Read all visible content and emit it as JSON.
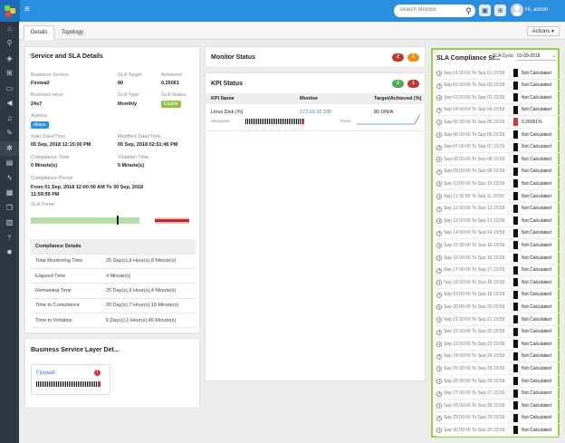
{
  "header": {
    "search_placeholder": "Search Monitor",
    "user_greeting": "Hi, admin"
  },
  "tabs": [
    {
      "label": "Details"
    },
    {
      "label": "Topology"
    }
  ],
  "actions_label": "Actions",
  "service": {
    "title": "Service and SLA Details",
    "fields": {
      "business_service_label": "Business Service",
      "business_service": "Firewall",
      "sla_target_label": "SLA Target",
      "sla_target": "80",
      "achieved_label": "Achieved",
      "achieved": "0.25061",
      "business_hour_label": "Business Hour",
      "business_hour": "24x7",
      "sla_type_label": "SLA Type",
      "sla_type": "Monthly",
      "sla_status_label": "SLA Status",
      "sla_status": "Enable",
      "actions_label": "Actions",
      "actions_badge": "dbase",
      "start_label": "Start Date/Time",
      "start": "05 Sep, 2018 12:15:00 PM",
      "modified_label": "Modified Date/Time",
      "modified": "05 Sep, 2018 02:51:46 PM",
      "compliance_time_label": "Compliance Time",
      "compliance_time": "0 Minute(s)",
      "violation_time_label": "Violation Time",
      "violation_time": "5 Minute(s)",
      "compliance_period_label": "Compliance Period",
      "compliance_period": "From 01 Sep, 2018 12:00:00 AM To 30 Sep, 2018 11:59:59 PM",
      "sla_trend_label": "SLA Trend"
    },
    "compliance_details": {
      "header": "Compliance Details",
      "rows": [
        {
          "label": "Total Monitoring Time",
          "value": "25 Day(s),9 Hour(s),8 Minute(s)"
        },
        {
          "label": "Elapsed Time",
          "value": "4 Minute(s)"
        },
        {
          "label": "Remaining Time",
          "value": "25 Day(s),9 Hour(s),4 Minute(s)"
        },
        {
          "label": "Time to Compliance",
          "value": "20 Day(s),7 Hour(s),18 Minute(s)"
        },
        {
          "label": "Time to Violation",
          "value": "5 Day(s),1 Hour(s),45 Minute(s)"
        }
      ]
    }
  },
  "layer": {
    "title": "Business Service Layer Det...",
    "card_name": "Firewall"
  },
  "monitor_status": {
    "title": "Monitor Status",
    "count_red": "2",
    "count_orange": "1"
  },
  "kpi_status": {
    "title": "KPI Status",
    "count_green": "2",
    "count_red": "1",
    "headers": [
      "KPI Name",
      "Monitor",
      "Target/Achieved (%)"
    ],
    "row": {
      "name": "Linux Disk (%)",
      "monitor": "172.16.10.230",
      "target_achieved": "80.0/N/A",
      "histogram_label": "Histogram",
      "trend_label": "Trend"
    }
  },
  "sla_compliance": {
    "title": "SLA Compliance St...",
    "cycle_label": "SLA Cycle",
    "cycle_value": "01-09-2018",
    "rows": [
      {
        "period": "Sep 01 00:00 To Sep 01 23:59",
        "status": "Not Calculated",
        "color": "#111111"
      },
      {
        "period": "Sep 02 00:00 To Sep 02 23:59",
        "status": "Not Calculated",
        "color": "#111111"
      },
      {
        "period": "Sep 03 00:00 To Sep 03 23:59",
        "status": "Not Calculated",
        "color": "#111111"
      },
      {
        "period": "Sep 04 00:00 To Sep 04 23:59",
        "status": "Not Calculated",
        "color": "#111111"
      },
      {
        "period": "Sep 05 00:00 To Sep 05 23:59",
        "status": "0.25061%",
        "color": "#d83535"
      },
      {
        "period": "Sep 06 00:00 To Sep 06 23:59",
        "status": "Not Calculated",
        "color": "#111111"
      },
      {
        "period": "Sep 07 00:00 To Sep 07 23:59",
        "status": "Not Calculated",
        "color": "#111111"
      },
      {
        "period": "Sep 08 00:00 To Sep 08 23:59",
        "status": "Not Calculated",
        "color": "#111111"
      },
      {
        "period": "Sep 09 00:00 To Sep 09 23:59",
        "status": "Not Calculated",
        "color": "#111111"
      },
      {
        "period": "Sep 10 00:00 To Sep 10 23:59",
        "status": "Not Calculated",
        "color": "#111111"
      },
      {
        "period": "Sep 11 00:00 To Sep 11 23:59",
        "status": "Not Calculated",
        "color": "#111111"
      },
      {
        "period": "Sep 12 00:00 To Sep 12 23:59",
        "status": "Not Calculated",
        "color": "#111111"
      },
      {
        "period": "Sep 13 00:00 To Sep 13 23:59",
        "status": "Not Calculated",
        "color": "#111111"
      },
      {
        "period": "Sep 14 00:00 To Sep 14 23:59",
        "status": "Not Calculated",
        "color": "#111111"
      },
      {
        "period": "Sep 15 00:00 To Sep 15 23:59",
        "status": "Not Calculated",
        "color": "#111111"
      },
      {
        "period": "Sep 16 00:00 To Sep 16 23:59",
        "status": "Not Calculated",
        "color": "#111111"
      },
      {
        "period": "Sep 17 00:00 To Sep 17 23:59",
        "status": "Not Calculated",
        "color": "#111111"
      },
      {
        "period": "Sep 18 00:00 To Sep 18 23:59",
        "status": "Not Calculated",
        "color": "#111111"
      },
      {
        "period": "Sep 19 00:00 To Sep 19 23:59",
        "status": "Not Calculated",
        "color": "#111111"
      },
      {
        "period": "Sep 20 00:00 To Sep 20 23:59",
        "status": "Not Calculated",
        "color": "#111111"
      },
      {
        "period": "Sep 21 00:00 To Sep 21 23:59",
        "status": "Not Calculated",
        "color": "#111111"
      },
      {
        "period": "Sep 22 00:00 To Sep 22 23:59",
        "status": "Not Calculated",
        "color": "#111111"
      },
      {
        "period": "Sep 23 00:00 To Sep 23 23:59",
        "status": "Not Calculated",
        "color": "#111111"
      },
      {
        "period": "Sep 24 00:00 To Sep 24 23:59",
        "status": "Not Calculated",
        "color": "#111111"
      },
      {
        "period": "Sep 25 00:00 To Sep 25 23:59",
        "status": "Not Calculated",
        "color": "#111111"
      },
      {
        "period": "Sep 26 00:00 To Sep 26 23:59",
        "status": "Not Calculated",
        "color": "#111111"
      },
      {
        "period": "Sep 27 00:00 To Sep 27 23:59",
        "status": "Not Calculated",
        "color": "#111111"
      },
      {
        "period": "Sep 28 00:00 To Sep 28 23:59",
        "status": "Not Calculated",
        "color": "#111111"
      },
      {
        "period": "Sep 29 00:00 To Sep 29 23:59",
        "status": "Not Calculated",
        "color": "#111111"
      },
      {
        "period": "Sep 30 00:00 To Sep 30 23:59",
        "status": "Not Calculated",
        "color": "#111111"
      }
    ]
  },
  "colors": {
    "accent": "#2a8fe0",
    "highlight": "#8dd63f",
    "danger": "#d83535",
    "warning": "#f08c1a",
    "success": "#4caf50"
  },
  "icons": [
    "home-icon",
    "search-icon",
    "monitor-icon",
    "topology-icon",
    "desktop-icon",
    "megaphone-icon",
    "bell-icon",
    "tools-icon",
    "gears-icon",
    "report-icon",
    "bolt-icon",
    "calendar-icon",
    "copy-icon",
    "document-icon",
    "branch-icon",
    "settings-icon"
  ]
}
